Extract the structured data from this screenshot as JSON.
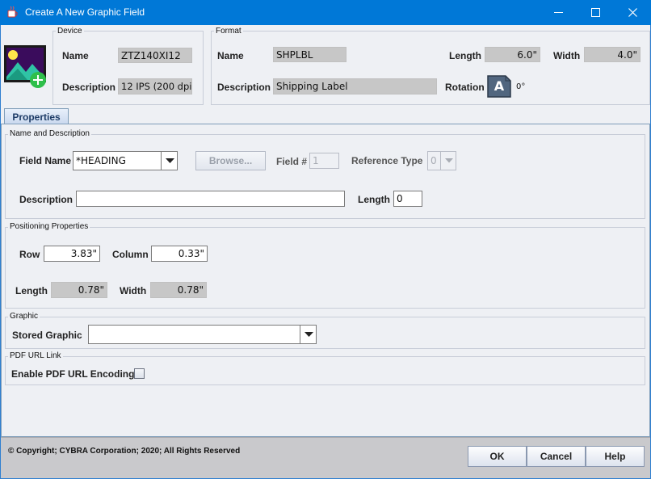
{
  "window": {
    "title": "Create A New Graphic Field",
    "app_icon": "java-cup-icon",
    "controls": [
      "minimize-icon",
      "maximize-icon",
      "close-icon"
    ]
  },
  "device": {
    "legend": "Device",
    "name_label": "Name",
    "name_value": "ZTZ140XI12",
    "description_label": "Description",
    "description_value": "12 IPS (200 dpi)"
  },
  "format": {
    "legend": "Format",
    "name_label": "Name",
    "name_value": "SHPLBL",
    "description_label": "Description",
    "description_value": "Shipping Label",
    "length_label": "Length",
    "length_value": "6.0\"",
    "width_label": "Width",
    "width_value": "4.0\"",
    "rotation_label": "Rotation",
    "rotation_glyph": "A",
    "rotation_value": "0°"
  },
  "tabs": [
    {
      "label": "Properties",
      "active": true
    }
  ],
  "name_and_description": {
    "legend": "Name and Description",
    "field_name_label": "Field Name",
    "field_name_value": "*HEADING",
    "browse_label": "Browse...",
    "field_number_label": "Field #",
    "field_number_value": "1",
    "reference_type_label": "Reference Type",
    "reference_type_value": "0",
    "description_label": "Description",
    "description_value": "",
    "length_label": "Length",
    "length_value": "0"
  },
  "positioning": {
    "legend": "Positioning Properties",
    "row_label": "Row",
    "row_value": "3.83\"",
    "column_label": "Column",
    "column_value": "0.33\"",
    "length_label": "Length",
    "length_value": "0.78\"",
    "width_label": "Width",
    "width_value": "0.78\""
  },
  "graphic": {
    "legend": "Graphic",
    "stored_graphic_label": "Stored Graphic",
    "stored_graphic_value": ""
  },
  "pdf_url_link": {
    "legend": "PDF URL Link",
    "enable_label": "Enable PDF URL Encoding",
    "enabled": false
  },
  "footer": {
    "copyright": "© Copyright; CYBRA Corporation; 2020; All Rights Reserved",
    "ok_label": "OK",
    "cancel_label": "Cancel",
    "help_label": "Help"
  },
  "colors": {
    "titlebar": "#0078d7",
    "tab_border": "#7f9db9",
    "readonly_field": "#c7c7c7",
    "background": "#eef0f4"
  }
}
